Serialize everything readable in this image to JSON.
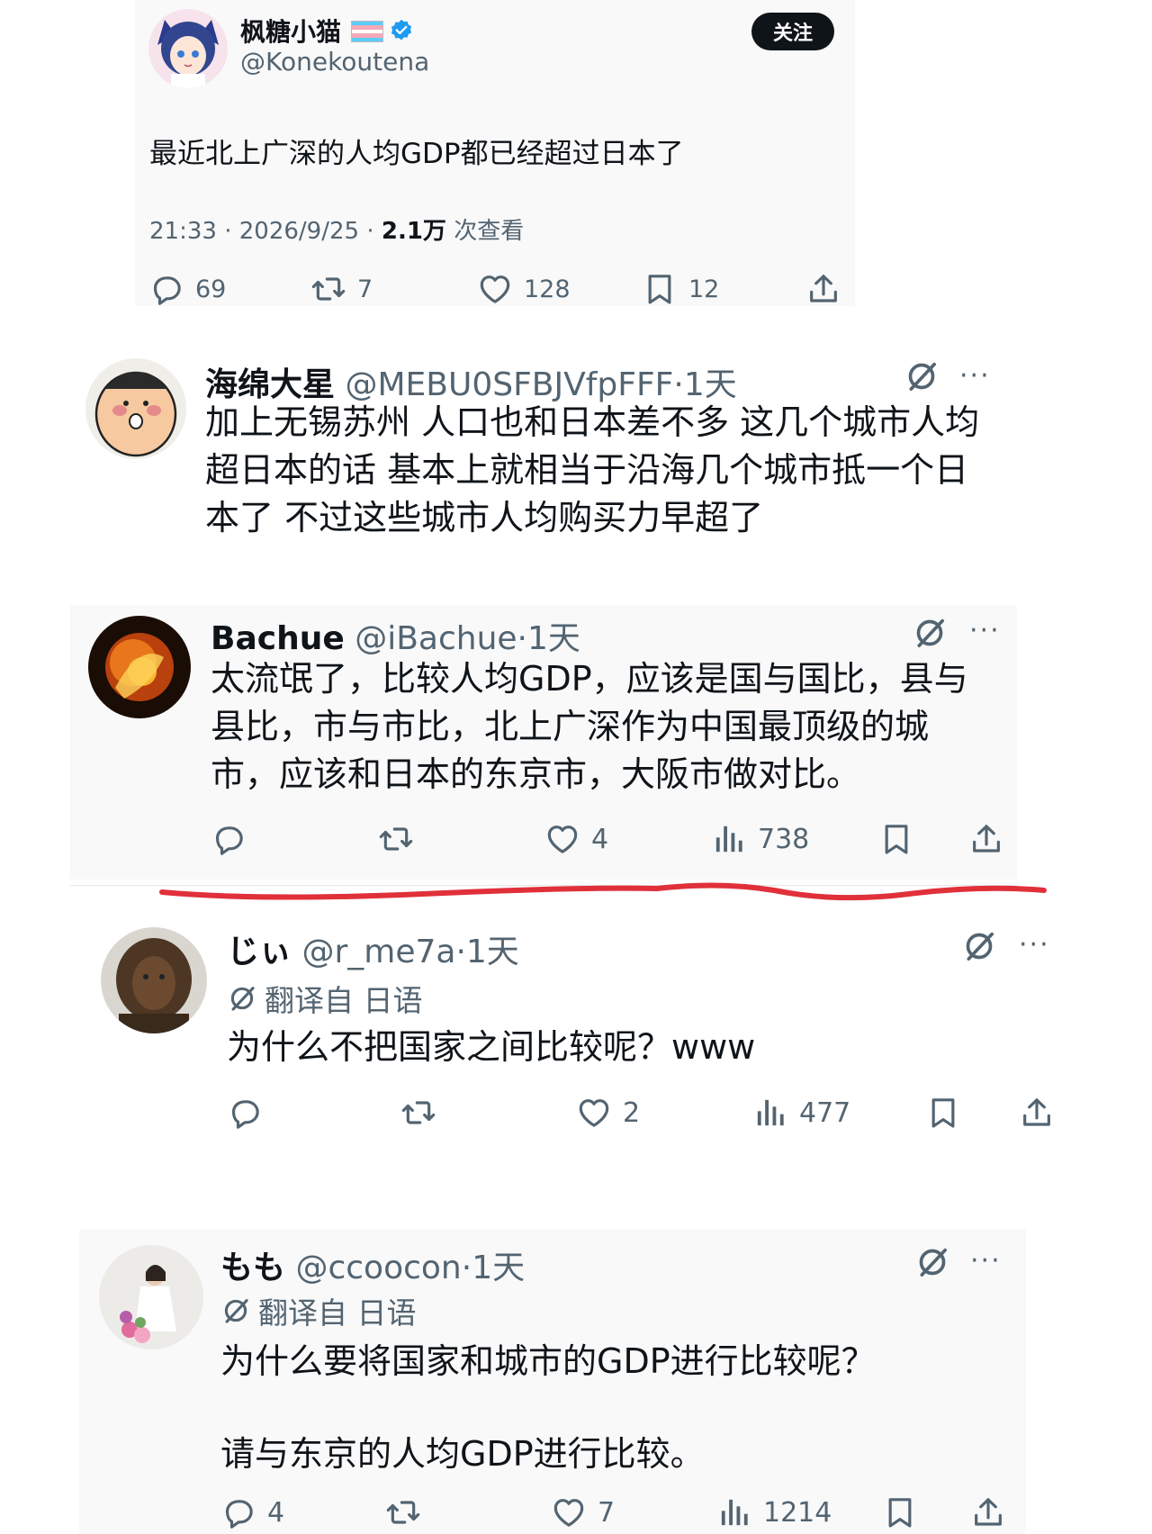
{
  "original_tweet": {
    "display_name": "枫糖小猫",
    "handle": "@Konekoutena",
    "follow_label": "关注",
    "text": "最近北上广深的人均GDP都已经超过日本了",
    "time": "21:33",
    "date": "2026/9/25",
    "views": "2.1万",
    "views_suffix": "次查看",
    "replies": "69",
    "retweets": "7",
    "likes": "128",
    "bookmarks": "12"
  },
  "replies": [
    {
      "display_name": "海绵大星",
      "handle": "@MEBU0SFBJVfpFFF",
      "age": "1天",
      "lines": [
        "加上无锡苏州 人口也和日本差不多 这几个城市人均",
        "超日本的话 基本上就相当于沿海几个城市抵一个日",
        "本了 不过这些城市人均购买力早超了"
      ]
    },
    {
      "display_name": "Bachue",
      "handle": "@iBachue",
      "age": "1天",
      "lines": [
        "太流氓了，比较人均GDP，应该是国与国比，县与",
        "县比，市与市比，北上广深作为中国最顶级的城",
        "市，应该和日本的东京市，大阪市做对比。"
      ],
      "likes": "4",
      "views": "738"
    },
    {
      "display_name": "じぃ",
      "handle": "@r_me7a",
      "age": "1天",
      "translated_label": "翻译自 日语",
      "lines": [
        "为什么不把国家之间比较呢？www"
      ],
      "likes": "2",
      "views": "477"
    },
    {
      "display_name": "もも",
      "handle": "@ccoocon",
      "age": "1天",
      "translated_label": "翻译自 日语",
      "lines": [
        "为什么要将国家和城市的GDP进行比较呢？",
        "请与东京的人均GDP进行比较。"
      ],
      "replies": "4",
      "likes": "7",
      "views": "1214"
    }
  ],
  "more_label": "···",
  "separator": "·",
  "colors": {
    "text": "#0f1419",
    "secondary": "#536471",
    "verified": "#1d9bf0",
    "annotation_line": "#e0303a"
  }
}
